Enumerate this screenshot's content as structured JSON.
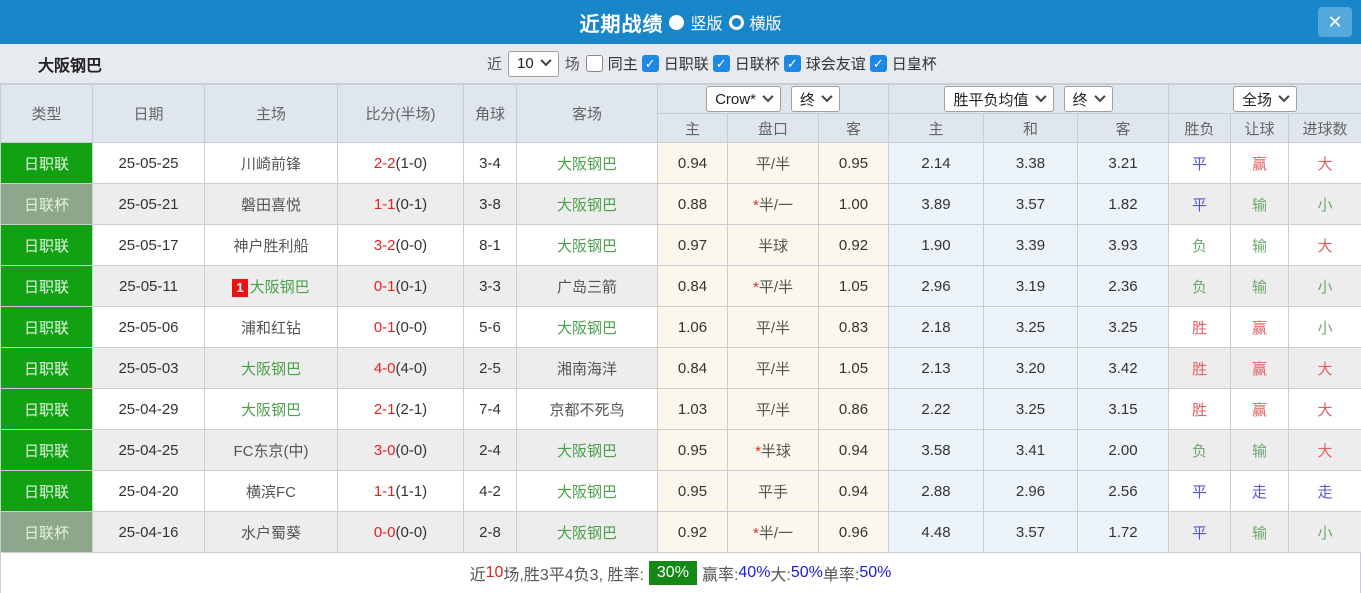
{
  "header": {
    "title": "近期战绩",
    "layout_options": [
      {
        "label": "竖版",
        "selected": true
      },
      {
        "label": "横版",
        "selected": false
      }
    ],
    "close_glyph": "✕"
  },
  "filter": {
    "team_name": "大阪钢巴",
    "near_label": "近",
    "matches_count": "10",
    "matches_label": "场",
    "checkboxes": [
      {
        "label": "同主",
        "checked": false
      },
      {
        "label": "日职联",
        "checked": true
      },
      {
        "label": "日联杯",
        "checked": true
      },
      {
        "label": "球会友谊",
        "checked": true
      },
      {
        "label": "日皇杯",
        "checked": true
      }
    ]
  },
  "table": {
    "left_headers": [
      "类型",
      "日期",
      "主场",
      "比分(半场)",
      "角球",
      "客场"
    ],
    "dropdowns": {
      "company": "Crow*",
      "company_time": "终",
      "avg": "胜平负均值",
      "avg_time": "终",
      "scope": "全场"
    },
    "sub_headers": [
      "主",
      "盘口",
      "客",
      "主",
      "和",
      "客",
      "胜负",
      "让球",
      "进球数"
    ],
    "rows": [
      {
        "type": "日职联",
        "type_variant": "bright",
        "date": "25-05-25",
        "home": "川崎前锋",
        "home_self": false,
        "home_badge": "",
        "score": "2-2",
        "half": "(1-0)",
        "corners": "3-4",
        "away": "大阪钢巴",
        "away_self": true,
        "odds_home": "0.94",
        "handicap": "平/半",
        "handicap_star": false,
        "odds_away": "0.95",
        "avg_win": "2.14",
        "avg_draw": "3.38",
        "avg_lose": "3.21",
        "result": {
          "text": "平",
          "color": "blue"
        },
        "handicap_result": {
          "text": "赢",
          "color": "red"
        },
        "goals_result": {
          "text": "大",
          "color": "red"
        }
      },
      {
        "type": "日联杯",
        "type_variant": "muted",
        "date": "25-05-21",
        "home": "磐田喜悦",
        "home_self": false,
        "home_badge": "",
        "score": "1-1",
        "half": "(0-1)",
        "corners": "3-8",
        "away": "大阪钢巴",
        "away_self": true,
        "odds_home": "0.88",
        "handicap": "半/一",
        "handicap_star": true,
        "odds_away": "1.00",
        "avg_win": "3.89",
        "avg_draw": "3.57",
        "avg_lose": "1.82",
        "result": {
          "text": "平",
          "color": "blue"
        },
        "handicap_result": {
          "text": "输",
          "color": "green"
        },
        "goals_result": {
          "text": "小",
          "color": "green"
        }
      },
      {
        "type": "日职联",
        "type_variant": "bright",
        "date": "25-05-17",
        "home": "神户胜利船",
        "home_self": false,
        "home_badge": "",
        "score": "3-2",
        "half": "(0-0)",
        "corners": "8-1",
        "away": "大阪钢巴",
        "away_self": true,
        "odds_home": "0.97",
        "handicap": "半球",
        "handicap_star": false,
        "odds_away": "0.92",
        "avg_win": "1.90",
        "avg_draw": "3.39",
        "avg_lose": "3.93",
        "result": {
          "text": "负",
          "color": "green"
        },
        "handicap_result": {
          "text": "输",
          "color": "green"
        },
        "goals_result": {
          "text": "大",
          "color": "red"
        }
      },
      {
        "type": "日职联",
        "type_variant": "bright",
        "date": "25-05-11",
        "home": "大阪钢巴",
        "home_self": true,
        "home_badge": "1",
        "score": "0-1",
        "half": "(0-1)",
        "corners": "3-3",
        "away": "广岛三箭",
        "away_self": false,
        "odds_home": "0.84",
        "handicap": "平/半",
        "handicap_star": true,
        "odds_away": "1.05",
        "avg_win": "2.96",
        "avg_draw": "3.19",
        "avg_lose": "2.36",
        "result": {
          "text": "负",
          "color": "green"
        },
        "handicap_result": {
          "text": "输",
          "color": "green"
        },
        "goals_result": {
          "text": "小",
          "color": "green"
        }
      },
      {
        "type": "日职联",
        "type_variant": "bright",
        "date": "25-05-06",
        "home": "浦和红钻",
        "home_self": false,
        "home_badge": "",
        "score": "0-1",
        "half": "(0-0)",
        "corners": "5-6",
        "away": "大阪钢巴",
        "away_self": true,
        "odds_home": "1.06",
        "handicap": "平/半",
        "handicap_star": false,
        "odds_away": "0.83",
        "avg_win": "2.18",
        "avg_draw": "3.25",
        "avg_lose": "3.25",
        "result": {
          "text": "胜",
          "color": "red"
        },
        "handicap_result": {
          "text": "赢",
          "color": "red"
        },
        "goals_result": {
          "text": "小",
          "color": "green"
        }
      },
      {
        "type": "日职联",
        "type_variant": "bright",
        "date": "25-05-03",
        "home": "大阪钢巴",
        "home_self": true,
        "home_badge": "",
        "score": "4-0",
        "half": "(4-0)",
        "corners": "2-5",
        "away": "湘南海洋",
        "away_self": false,
        "odds_home": "0.84",
        "handicap": "平/半",
        "handicap_star": false,
        "odds_away": "1.05",
        "avg_win": "2.13",
        "avg_draw": "3.20",
        "avg_lose": "3.42",
        "result": {
          "text": "胜",
          "color": "red"
        },
        "handicap_result": {
          "text": "赢",
          "color": "red"
        },
        "goals_result": {
          "text": "大",
          "color": "red"
        }
      },
      {
        "type": "日职联",
        "type_variant": "bright",
        "date": "25-04-29",
        "home": "大阪钢巴",
        "home_self": true,
        "home_badge": "",
        "score": "2-1",
        "half": "(2-1)",
        "corners": "7-4",
        "away": "京都不死鸟",
        "away_self": false,
        "odds_home": "1.03",
        "handicap": "平/半",
        "handicap_star": false,
        "odds_away": "0.86",
        "avg_win": "2.22",
        "avg_draw": "3.25",
        "avg_lose": "3.15",
        "result": {
          "text": "胜",
          "color": "red"
        },
        "handicap_result": {
          "text": "赢",
          "color": "red"
        },
        "goals_result": {
          "text": "大",
          "color": "red"
        }
      },
      {
        "type": "日职联",
        "type_variant": "bright",
        "date": "25-04-25",
        "home": "FC东京(中)",
        "home_self": false,
        "home_badge": "",
        "score": "3-0",
        "half": "(0-0)",
        "corners": "2-4",
        "away": "大阪钢巴",
        "away_self": true,
        "odds_home": "0.95",
        "handicap": "半球",
        "handicap_star": true,
        "odds_away": "0.94",
        "avg_win": "3.58",
        "avg_draw": "3.41",
        "avg_lose": "2.00",
        "result": {
          "text": "负",
          "color": "green"
        },
        "handicap_result": {
          "text": "输",
          "color": "green"
        },
        "goals_result": {
          "text": "大",
          "color": "red"
        }
      },
      {
        "type": "日职联",
        "type_variant": "bright",
        "date": "25-04-20",
        "home": "横滨FC",
        "home_self": false,
        "home_badge": "",
        "score": "1-1",
        "half": "(1-1)",
        "corners": "4-2",
        "away": "大阪钢巴",
        "away_self": true,
        "odds_home": "0.95",
        "handicap": "平手",
        "handicap_star": false,
        "odds_away": "0.94",
        "avg_win": "2.88",
        "avg_draw": "2.96",
        "avg_lose": "2.56",
        "result": {
          "text": "平",
          "color": "blue"
        },
        "handicap_result": {
          "text": "走",
          "color": "blue"
        },
        "goals_result": {
          "text": "走",
          "color": "blue"
        }
      },
      {
        "type": "日联杯",
        "type_variant": "muted",
        "date": "25-04-16",
        "home": "水户蜀葵",
        "home_self": false,
        "home_badge": "",
        "score": "0-0",
        "half": "(0-0)",
        "corners": "2-8",
        "away": "大阪钢巴",
        "away_self": true,
        "odds_home": "0.92",
        "handicap": "半/一",
        "handicap_star": true,
        "odds_away": "0.96",
        "avg_win": "4.48",
        "avg_draw": "3.57",
        "avg_lose": "1.72",
        "result": {
          "text": "平",
          "color": "blue"
        },
        "handicap_result": {
          "text": "输",
          "color": "green"
        },
        "goals_result": {
          "text": "小",
          "color": "green"
        }
      }
    ]
  },
  "footer": {
    "segments": [
      {
        "text": "近",
        "style": "gray"
      },
      {
        "text": "10",
        "style": "red"
      },
      {
        "text": "场,胜3平4负3, 胜率:",
        "style": "gray"
      },
      {
        "text": "30%",
        "style": "badge"
      },
      {
        "text": " 赢率:",
        "style": "gray"
      },
      {
        "text": "40%",
        "style": "blue"
      },
      {
        "text": " 大:",
        "style": "gray"
      },
      {
        "text": "50%",
        "style": "blue"
      },
      {
        "text": " 单率:",
        "style": "gray"
      },
      {
        "text": "50%",
        "style": "blue"
      }
    ]
  }
}
